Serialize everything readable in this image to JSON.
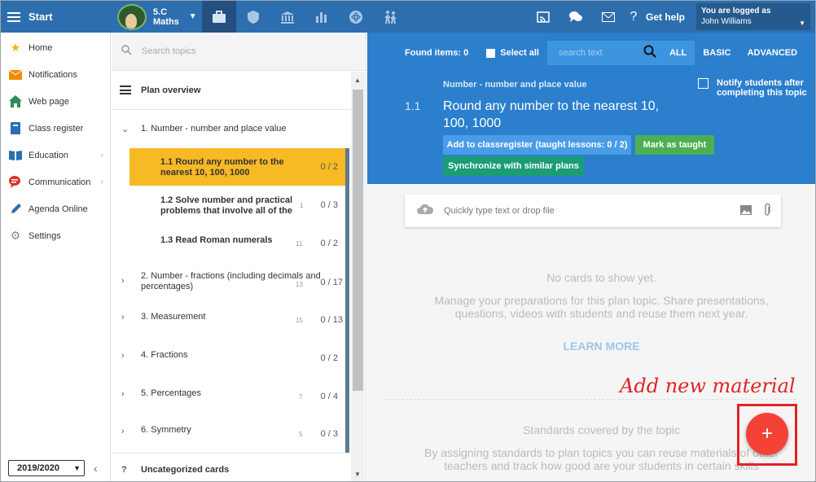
{
  "topbar": {
    "start_label": "Start",
    "class_line1": "5.C",
    "class_line2": "Maths",
    "help_label": "Get help",
    "logged_label": "You are logged as",
    "user_name": "John Williams"
  },
  "sidebar": {
    "items": [
      {
        "label": "Home",
        "icon": "star-icon",
        "color": "#f5b400"
      },
      {
        "label": "Notifications",
        "icon": "envelope-icon",
        "color": "#f08c00"
      },
      {
        "label": "Web page",
        "icon": "house-icon",
        "color": "#2e8b57"
      },
      {
        "label": "Class register",
        "icon": "book-icon",
        "color": "#2a6fb5"
      },
      {
        "label": "Education",
        "icon": "open-book-icon",
        "color": "#2a6fb5"
      },
      {
        "label": "Communication",
        "icon": "chat-icon",
        "color": "#d9342b"
      },
      {
        "label": "Agenda Online",
        "icon": "pen-icon",
        "color": "#2a6fb5"
      },
      {
        "label": "Settings",
        "icon": "gear-icon",
        "color": "#888888"
      }
    ],
    "year": "2019/2020"
  },
  "topics": {
    "search_placeholder": "Search topics",
    "plan_overview": "Plan overview",
    "rows": [
      {
        "label": "1. Number - number and place value",
        "count": "",
        "progress": ""
      },
      {
        "label": "1.1 Round any number to the nearest 10, 100, 1000",
        "count": "",
        "progress": "0 / 2"
      },
      {
        "label": "1.2 Solve number and practical problems that involve all of the",
        "count": "1",
        "progress": "0 / 3"
      },
      {
        "label": "1.3 Read Roman numerals",
        "count": "11",
        "progress": "0 / 2"
      },
      {
        "label": "2. Number - fractions (including decimals and percentages)",
        "count": "13",
        "progress": "0 / 17"
      },
      {
        "label": "3. Measurement",
        "count": "15",
        "progress": "0 / 13"
      },
      {
        "label": "4. Fractions",
        "count": "",
        "progress": "0 / 2"
      },
      {
        "label": "5. Percentages",
        "count": "7",
        "progress": "0 / 4"
      },
      {
        "label": "6. Symmetry",
        "count": "5",
        "progress": "0 / 3"
      },
      {
        "label": "Uncategorized cards",
        "count": "",
        "progress": ""
      }
    ]
  },
  "main": {
    "found_label": "Found items: 0",
    "select_all": "Select all",
    "search_placeholder": "search text",
    "tabs": [
      "ALL",
      "BASIC",
      "ADVANCED"
    ],
    "topic_category": "Number - number and place value",
    "topic_number": "1.1",
    "topic_title": "Round any number to the nearest 10, 100, 1000",
    "notify_label": "Notify students after completing this topic",
    "btn_add_register": "Add to classregister (taught lessons: 0 / 2)",
    "btn_mark_taught": "Mark as taught",
    "btn_sync": "Synchronize with similar plans",
    "drop_placeholder": "Quickly type text or drop file",
    "no_cards": "No cards to show yet.",
    "manage_text": "Manage your preparations for this plan topic. Share presentations, questions, videos with students and reuse them next year.",
    "learn_more": "LEARN MORE",
    "standards_title": "Standards covered by the topic",
    "standards_text": "By assigning standards to plan topics you can reuse materials of other teachers and track how good are your students in certain skills",
    "annotation": "Add new material",
    "fab_label": "+"
  },
  "colors": {
    "topbar": "#2d6fae",
    "panel_blue": "#2b7fcd",
    "selected": "#f7b924",
    "fab": "#f44336",
    "annotation": "#e02424"
  }
}
